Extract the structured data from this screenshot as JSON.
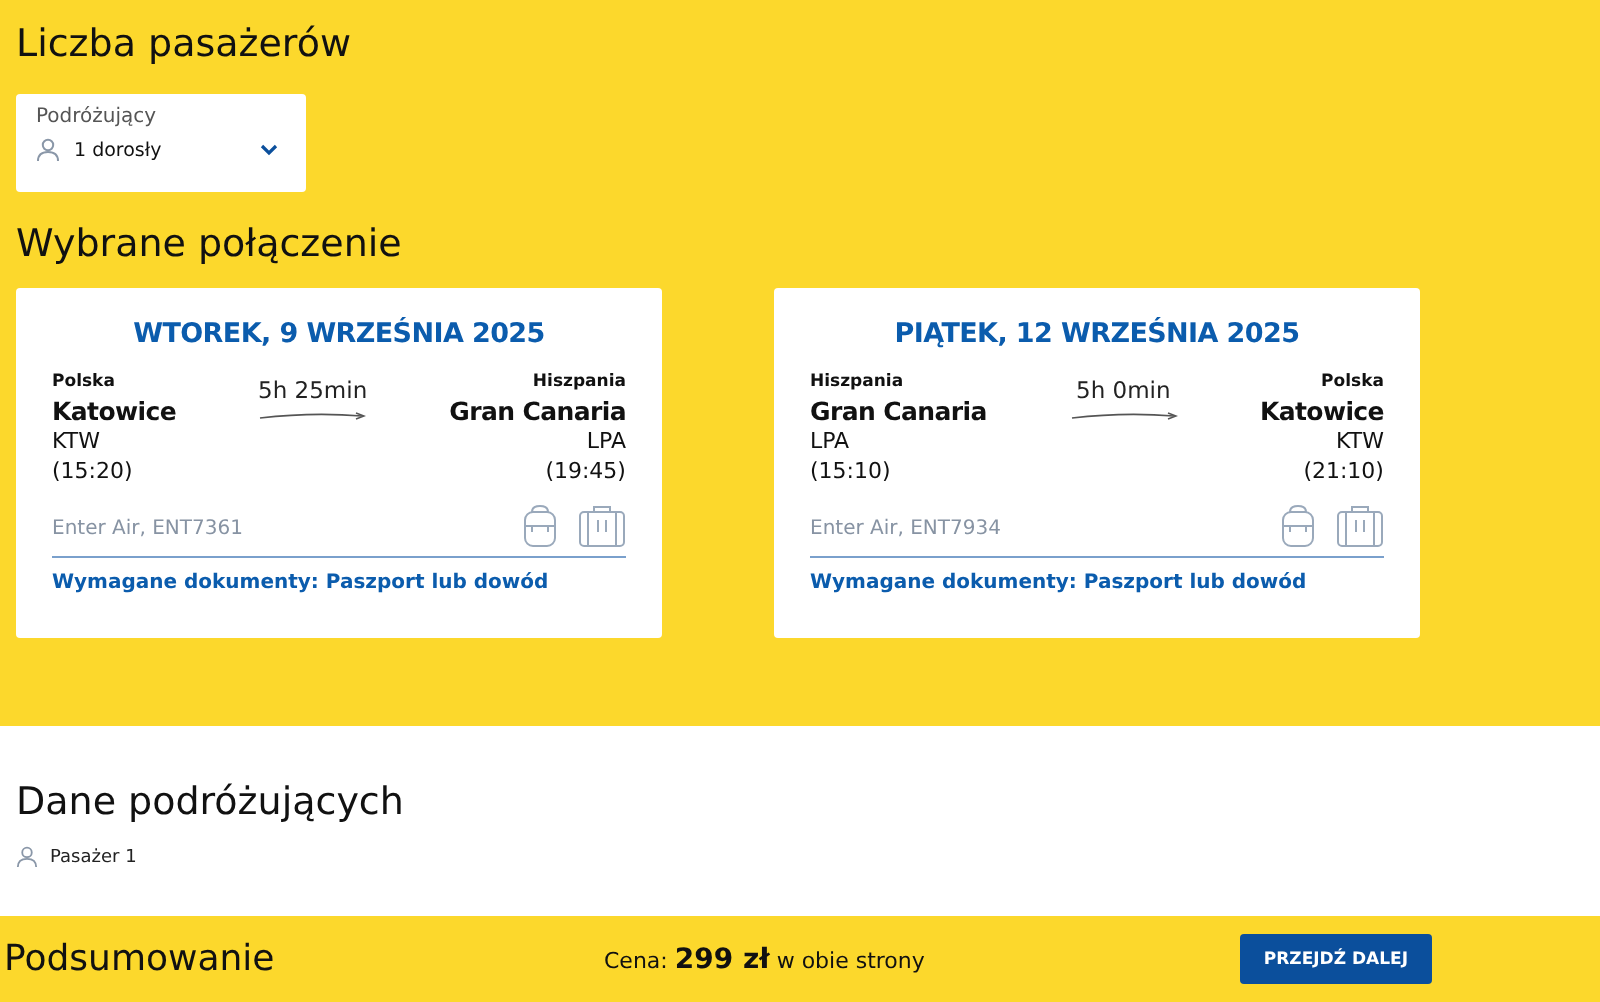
{
  "passengers": {
    "title": "Liczba pasażerów",
    "field_label": "Podróżujący",
    "value": "1 dorosły"
  },
  "connection": {
    "title": "Wybrane połączenie",
    "flights": [
      {
        "date": "WTOREK, 9 WRZEŚNIA 2025",
        "duration": "5h 25min",
        "from": {
          "country": "Polska",
          "city": "Katowice",
          "code": "KTW",
          "time": "(15:20)"
        },
        "to": {
          "country": "Hiszpania",
          "city": "Gran Canaria",
          "code": "LPA",
          "time": "(19:45)"
        },
        "carrier": "Enter Air, ENT7361",
        "documents": "Wymagane dokumenty: Paszport lub dowód"
      },
      {
        "date": "PIĄTEK, 12 WRZEŚNIA 2025",
        "duration": "5h 0min",
        "from": {
          "country": "Hiszpania",
          "city": "Gran Canaria",
          "code": "LPA",
          "time": "(15:10)"
        },
        "to": {
          "country": "Polska",
          "city": "Katowice",
          "code": "KTW",
          "time": "(21:10)"
        },
        "carrier": "Enter Air, ENT7934",
        "documents": "Wymagane dokumenty: Paszport lub dowód"
      }
    ]
  },
  "travellers": {
    "title": "Dane podróżujących",
    "items": [
      "Pasażer 1"
    ]
  },
  "summary": {
    "title": "Podsumowanie",
    "price": "Cena: **299 zł** w obie strony",
    "button": "PRZEJDŹ DALEJ"
  }
}
